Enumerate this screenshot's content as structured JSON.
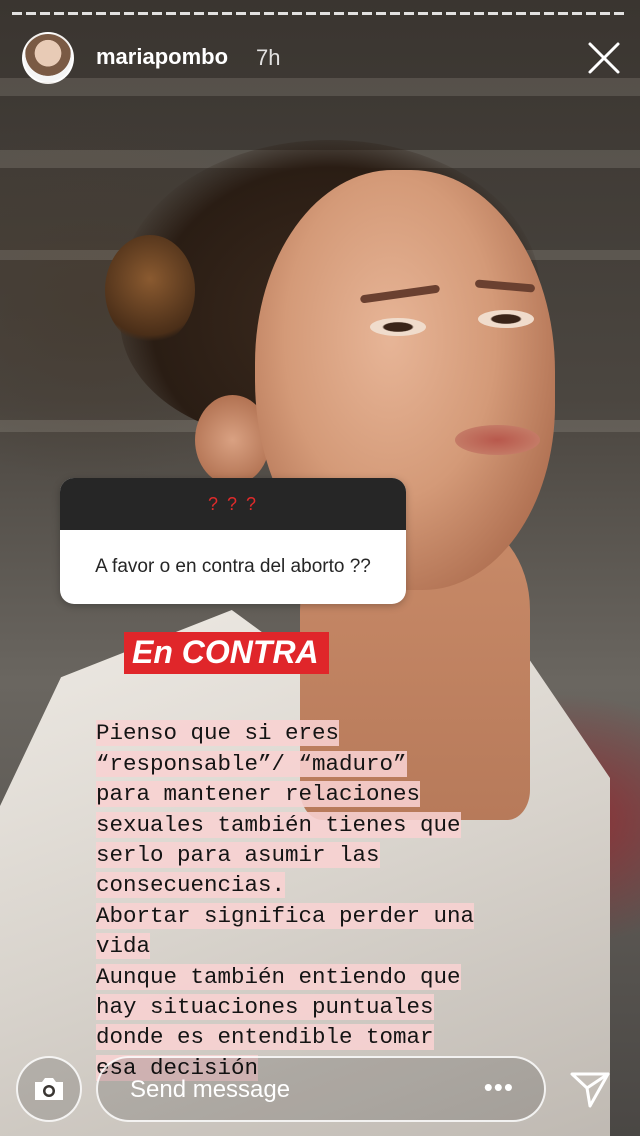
{
  "story": {
    "username": "mariapombo",
    "timestamp": "7h"
  },
  "question": {
    "header": "? ? ?",
    "text": "A favor o en contra del aborto ??"
  },
  "answer": {
    "label": "En CONTRA",
    "lines": [
      "Pienso que si eres",
      "“responsable”/ “maduro”",
      "para mantener relaciones",
      "sexuales también tienes que",
      "serlo para asumir las",
      "consecuencias.",
      "Abortar significa perder una",
      "vida",
      "Aunque también entiendo que",
      "hay situaciones puntuales",
      "donde es entendible tomar",
      "esa decisión"
    ]
  },
  "footer": {
    "placeholder": "Send message",
    "more_label": "•••"
  },
  "icons": {
    "close": "close-icon",
    "camera": "camera-icon",
    "send": "send-icon"
  },
  "colors": {
    "answer_label_bg": "#e0262a",
    "question_header_bg": "#262626",
    "question_header_text": "#e02b2b",
    "highlight": "#f8d2d2"
  }
}
